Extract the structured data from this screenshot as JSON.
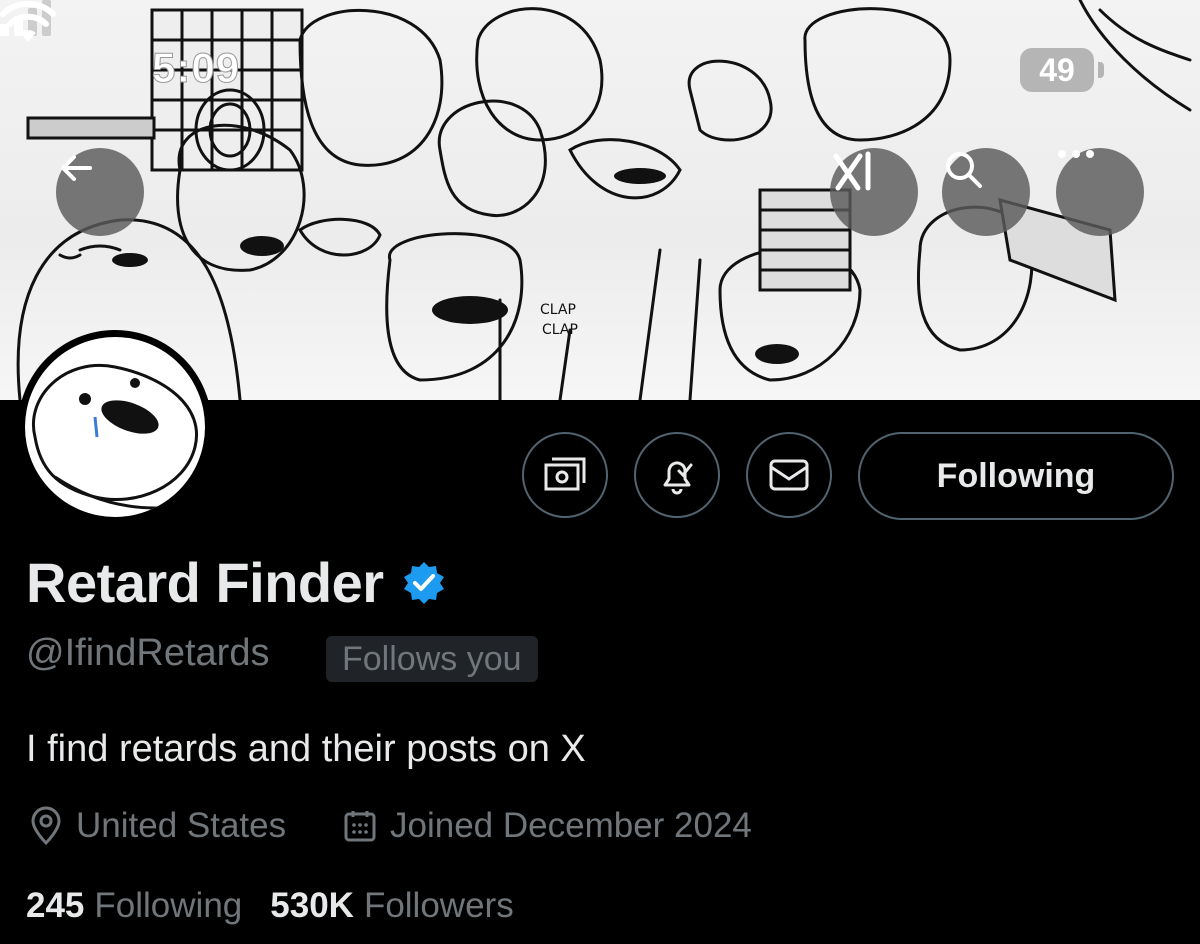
{
  "status_bar": {
    "time": "5:09",
    "battery": "49"
  },
  "header_buttons": [
    "back-arrow-icon",
    "grok-icon",
    "search-icon",
    "more-icon"
  ],
  "actions": {
    "follow_label": "Following"
  },
  "profile": {
    "name": "Retard Finder",
    "handle": "@IfindRetards",
    "follows_you": "Follows you",
    "bio": "I find retards and their posts on X",
    "location": "United States",
    "joined": "Joined December 2024",
    "following_count": "245",
    "following_label": "Following",
    "followers_count": "530K",
    "followers_label": "Followers"
  },
  "banner_caption": {
    "line1": "CLAP",
    "line2": "CLAP"
  },
  "colors": {
    "verified": "#1d9bf0",
    "muted": "#71767b",
    "text": "#e7e9ea",
    "border": "#536471"
  }
}
